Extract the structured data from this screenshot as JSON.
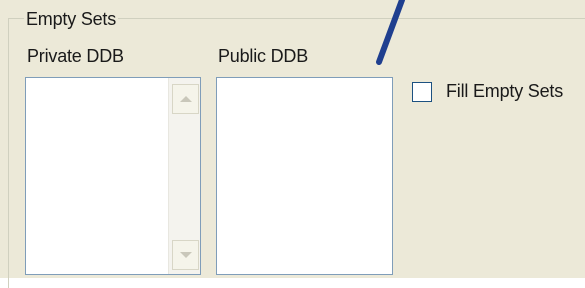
{
  "group": {
    "title": "Empty Sets"
  },
  "private_ddb": {
    "label": "Private DDB",
    "items": []
  },
  "public_ddb": {
    "label": "Public DDB",
    "items": []
  },
  "fill_empty_sets": {
    "label": "Fill Empty Sets",
    "checked": false
  },
  "colors": {
    "panel_bg": "#ece9d8",
    "listbox_border": "#7f9db9",
    "checkbox_border": "#1c5180",
    "annotation_stroke": "#1f3f8f"
  },
  "icons": {
    "scroll_up": "scroll-up-arrow-icon",
    "scroll_down": "scroll-down-arrow-icon"
  }
}
